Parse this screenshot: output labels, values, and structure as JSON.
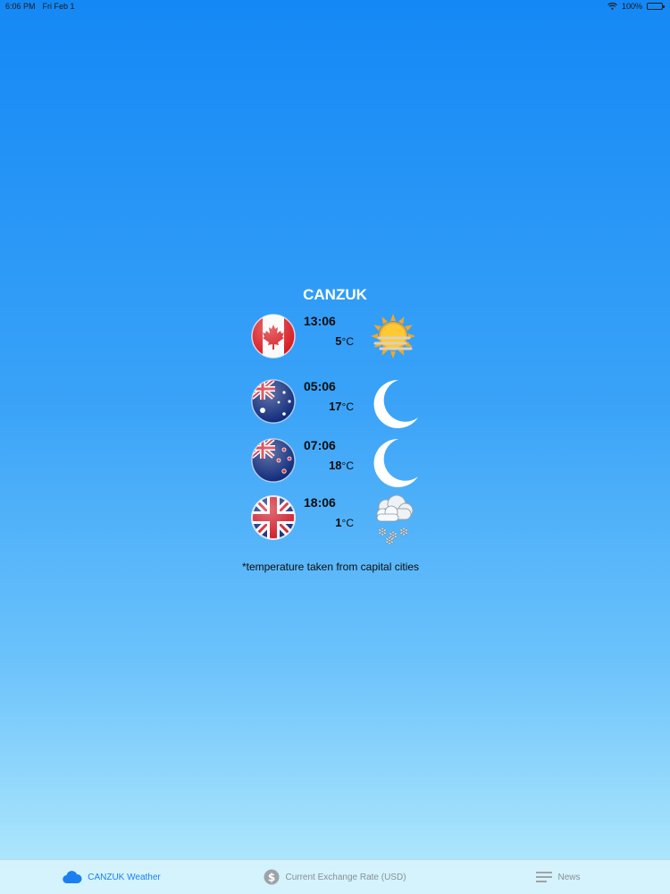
{
  "status_bar": {
    "time": "6:06 PM",
    "date": "Fri Feb 1",
    "battery": "100%"
  },
  "title": "CANZUK",
  "countries": [
    {
      "time": "13:06",
      "temp": "5",
      "unit": "°C",
      "weather_icon": "sun-fog-icon"
    },
    {
      "time": "05:06",
      "temp": "17",
      "unit": "°C",
      "weather_icon": "moon-icon"
    },
    {
      "time": "07:06",
      "temp": "18",
      "unit": "°C",
      "weather_icon": "moon-icon"
    },
    {
      "time": "18:06",
      "temp": "1",
      "unit": "°C",
      "weather_icon": "snow-cloud-icon"
    }
  ],
  "footnote": "*temperature taken from capital cities",
  "tabs": [
    {
      "label": "CANZUK Weather",
      "icon": "cloud-icon",
      "active": true
    },
    {
      "label": "Current Exchange Rate (USD)",
      "icon": "dollar-icon",
      "active": false
    },
    {
      "label": "News",
      "icon": "news-icon",
      "active": false
    }
  ],
  "colors": {
    "accent": "#1b7ff2",
    "inactive": "#8a8f94"
  }
}
